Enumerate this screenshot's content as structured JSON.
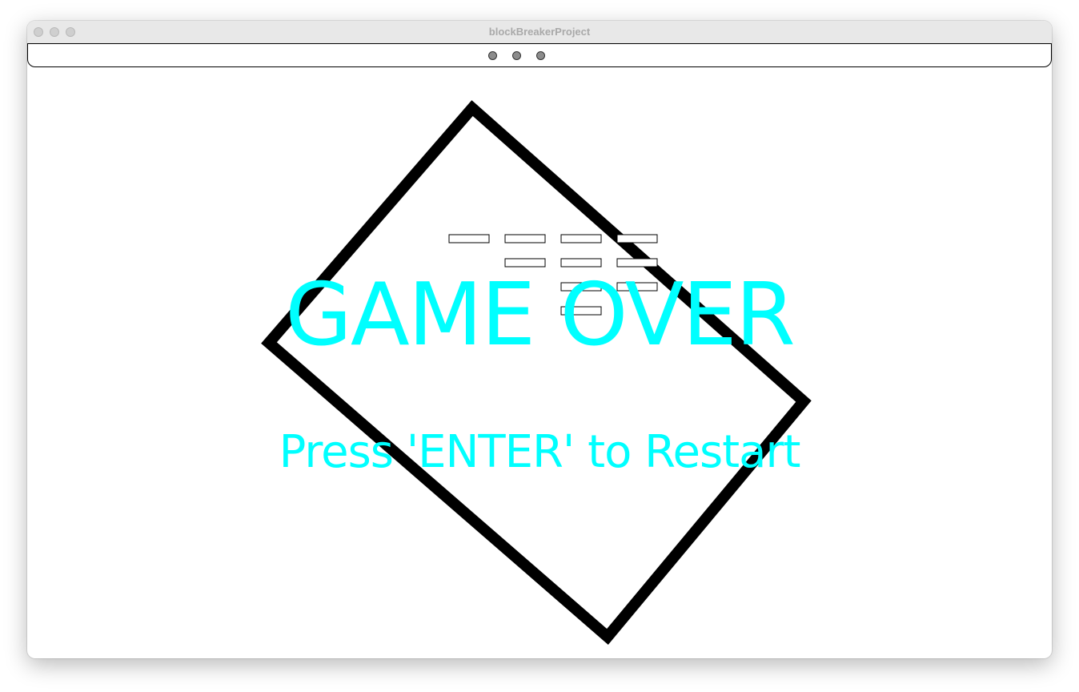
{
  "window": {
    "title": "blockBreakerProject"
  },
  "toolbar": {
    "dots": [
      "dot",
      "dot",
      "dot"
    ]
  },
  "game": {
    "game_over_text": "GAME OVER",
    "restart_text": "Press 'ENTER' to Restart",
    "text_color": "#00ffff",
    "frame_color": "#000000",
    "frame_shape": "rotated-square",
    "brick_rows": [
      [
        true,
        true,
        true,
        true
      ],
      [
        false,
        true,
        true,
        true
      ],
      [
        false,
        false,
        true,
        true
      ],
      [
        false,
        false,
        true,
        false
      ]
    ]
  }
}
